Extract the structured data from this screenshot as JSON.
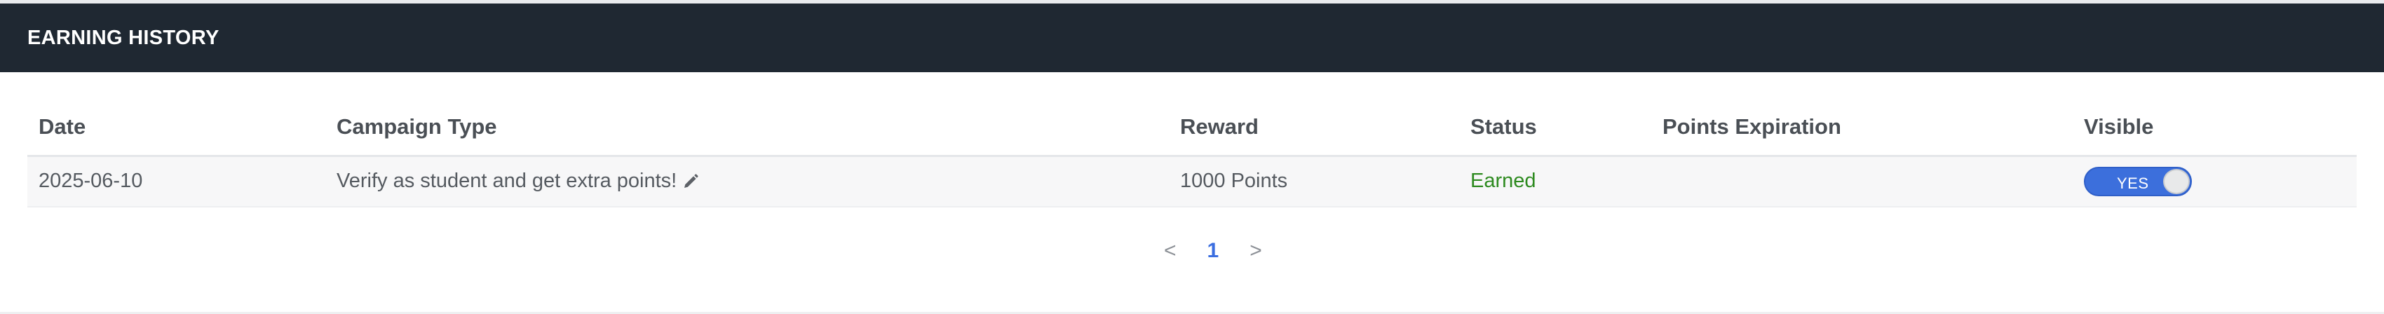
{
  "panel": {
    "title": "EARNING HISTORY"
  },
  "table": {
    "columns": [
      "Date",
      "Campaign Type",
      "Reward",
      "Status",
      "Points Expiration",
      "Visible"
    ],
    "rows": [
      {
        "date": "2025-06-10",
        "campaign_type": "Verify as student and get extra points!",
        "campaign_icon": "pencil-icon",
        "reward": "1000 Points",
        "status": "Earned",
        "points_expiration": "",
        "visible": "YES"
      }
    ]
  },
  "pagination": {
    "prev": "<",
    "current_page": "1",
    "next": ">"
  },
  "colors": {
    "header_bg": "#1f2832",
    "status_earned": "#2d8a1f",
    "toggle_on": "#3c6fdc",
    "page_active": "#3b6ee0"
  }
}
